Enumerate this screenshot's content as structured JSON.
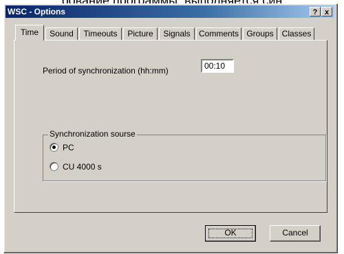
{
  "background_text": "рование программы, выполняется син",
  "window": {
    "title": "WSC - Options",
    "help_label": "?",
    "close_label": "x"
  },
  "tabs": [
    {
      "label": "Time",
      "active": true
    },
    {
      "label": "Sound"
    },
    {
      "label": "Timeouts"
    },
    {
      "label": "Picture"
    },
    {
      "label": "Signals"
    },
    {
      "label": "Comments"
    },
    {
      "label": "Groups"
    },
    {
      "label": "Classes"
    }
  ],
  "time_panel": {
    "period_label": "Period of synchronization (hh:mm)",
    "period_value": "00:10",
    "sync_group_label": "Synchronization sourse",
    "sources": [
      {
        "label": "PC",
        "selected": true
      },
      {
        "label": "CU 4000 s",
        "selected": false
      }
    ]
  },
  "buttons": {
    "ok_label": "OK",
    "cancel_label": "Cancel"
  },
  "colors": {
    "face": "#d4d0c8",
    "title_start": "#0a246a",
    "title_end": "#a6caf0"
  }
}
